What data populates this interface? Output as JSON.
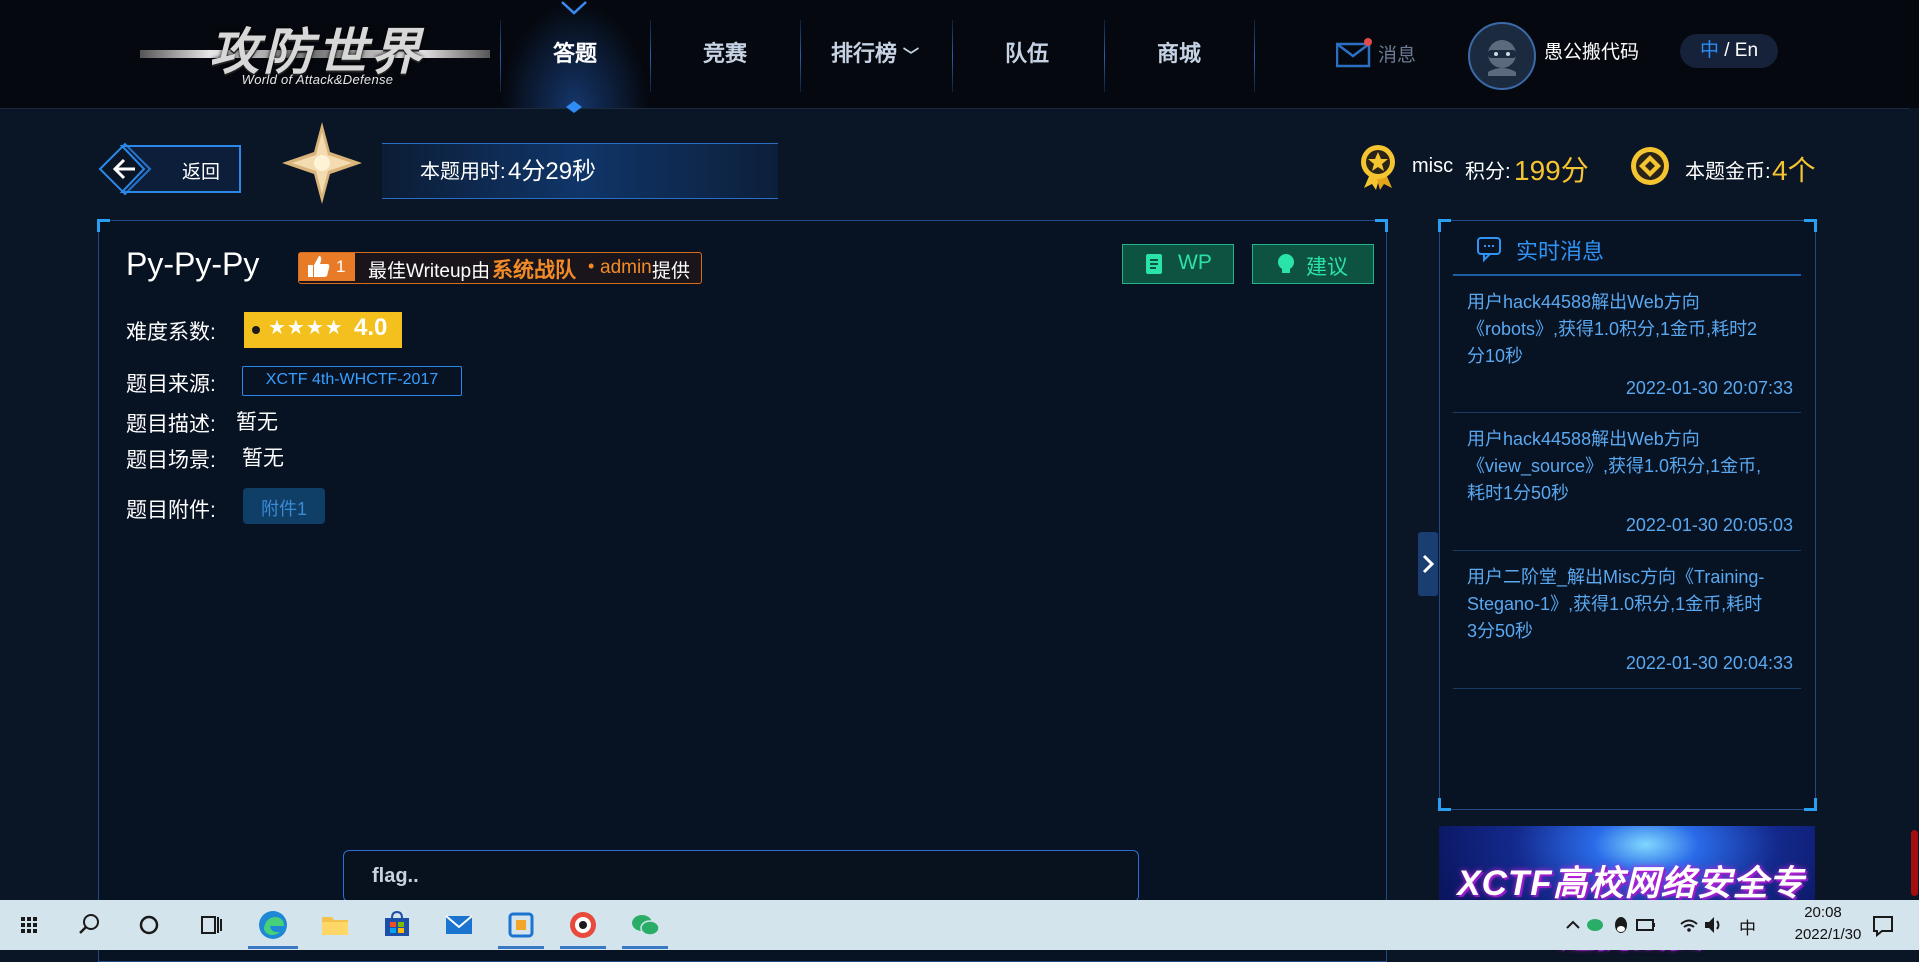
{
  "nav": {
    "logo_main": "攻防世界",
    "logo_sub": "World of Attack&Defense",
    "items": [
      {
        "label": "答题"
      },
      {
        "label": "竞赛"
      },
      {
        "label": "排行榜"
      },
      {
        "label": "队伍"
      },
      {
        "label": "商城"
      }
    ],
    "active_item": "答题",
    "messages_label": "消息",
    "username": "愚公搬代码",
    "lang_zh": "中",
    "lang_sep": " / ",
    "lang_en": "En"
  },
  "subheader": {
    "back_label": "返回",
    "time_label": "本题用时:",
    "time_value": "4分29秒",
    "score_category": "misc",
    "score_label": "积分:",
    "score_value": "199分",
    "coin_label": "本题金币:",
    "coin_value": "4个"
  },
  "task": {
    "title": "Py-Py-Py",
    "writeup": {
      "likes": "1",
      "text_before": "最佳Writeup由",
      "team": "系统战队",
      "dot": "•",
      "author": "admin",
      "text_after": "提供"
    },
    "wp_button": "WP",
    "advice_button": "建议",
    "difficulty_label": "难度系数:",
    "difficulty_stars": "★★★★",
    "difficulty_value": "4.0",
    "source_label": "题目来源:",
    "source_value": "XCTF 4th-WHCTF-2017",
    "description_label": "题目描述:",
    "description_value": "暂无",
    "scene_label": "题目场景:",
    "scene_value": "暂无",
    "attachment_label": "题目附件:",
    "attachment_button": "附件1",
    "flag_placeholder": "flag.."
  },
  "realtime": {
    "title": "实时消息",
    "items": [
      {
        "lines": [
          "用户hack44588解出Web方向",
          "《robots》,获得1.0积分,1金币,耗时2",
          "分10秒"
        ],
        "time": "2022-01-30 20:07:33"
      },
      {
        "lines": [
          "用户hack44588解出Web方向",
          "《view_source》,获得1.0积分,1金币,",
          "耗时1分50秒"
        ],
        "time": "2022-01-30 20:05:03"
      },
      {
        "lines": [
          "用户二阶堂_解出Misc方向《Training-",
          "Stegano-1》,获得1.0积分,1金币,耗时",
          "3分50秒"
        ],
        "time": "2022-01-30 20:04:33"
      }
    ],
    "banner_text": "XCTF高校网络安全专题挑战赛"
  },
  "taskbar": {
    "clock_time": "20:08",
    "clock_date": "2022/1/30",
    "ime": "中",
    "apps": [
      "start-icon",
      "search-icon",
      "cortana-icon",
      "task-view-icon",
      "edge-icon",
      "file-explorer-icon",
      "store-icon",
      "mail-icon",
      "app-icon",
      "camera-app-icon",
      "wechat-icon"
    ]
  },
  "colors": {
    "accent": "#2b8cf5",
    "gold": "#f5c431",
    "orange": "#f28b27",
    "green": "#2ae3a8",
    "background": "#0a1525"
  }
}
